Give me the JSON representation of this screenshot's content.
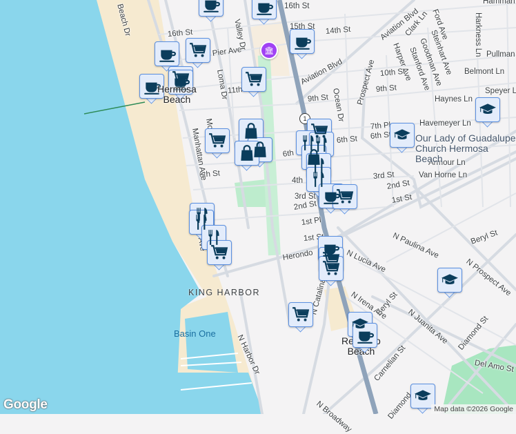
{
  "map": {
    "places": {
      "hermosa_1": "Hermosa",
      "hermosa_2": "Beach",
      "redondo_1": "Redondo",
      "redondo_2": "Beach",
      "king_harbor": "KING HARBOR",
      "basin_one": "Basin One",
      "church_1": "Our Lady of Guadalupe",
      "church_2": "Church Hermosa Beach"
    },
    "highway_shield": "1",
    "streets": [
      "16th St",
      "15th St",
      "14th St",
      "16th St",
      "Pier Ave",
      "Valley Dr",
      "Loma Dr",
      "11th St",
      "Aviation Blvd",
      "Aviation Blvd",
      "Prospect Ave",
      "Harper Ave",
      "Clark Ln",
      "Stanford Ave",
      "Goodman Ave",
      "Steinhart Ave",
      "Ford Ave",
      "Harkness Ln",
      "Hamman",
      "Pullman Ln",
      "Belmont Ln",
      "10th St",
      "9th St",
      "9th St",
      "Ocean Dr",
      "Speyer Ln",
      "Haynes Ln",
      "Havemeyer Ln",
      "7th Pl",
      "6th St",
      "6th St",
      "6th St",
      "Armour Ln",
      "Van Horne Ln",
      "3rd St",
      "2nd St",
      "1st St",
      "4th",
      "3rd St",
      "2nd St",
      "1st Pl",
      "1st St",
      "Herondo",
      "N Lucia Ave",
      "N Paulina Ave",
      "Beryl St",
      "N Prospect Ave",
      "N Irena Ave",
      "N Catalina",
      "Beryl St",
      "N Juanita Ave",
      "Diamond St",
      "Del Amo St",
      "Carnelian St",
      "N Broadway",
      "Diamond",
      "6th St",
      "Manhattan Ave",
      "Monterey",
      "Hermosa Ave",
      "Beach Dr",
      "N Harbor Dr"
    ],
    "markers": [
      "cafe",
      "cafe",
      "cafe",
      "cafe",
      "shopping-cart",
      "shopping-cart",
      "cafe",
      "cafe",
      "shopping-cart",
      "shopping-cart",
      "shopping-bag",
      "shopping-bag",
      "shopping-bag",
      "shopping-cart",
      "restaurant",
      "restaurant",
      "shopping-bag",
      "restaurant",
      "restaurant",
      "cafe",
      "shopping-cart",
      "restaurant",
      "restaurant",
      "restaurant",
      "shopping-cart",
      "cafe",
      "shopping-cart",
      "shopping-cart",
      "shopping-cart",
      "school",
      "school",
      "school",
      "school",
      "cafe",
      "school"
    ],
    "museum_icon": "museum-icon",
    "colors": {
      "water": "#8ad6ec",
      "sand": "#f6ead0",
      "land": "#f4f3f4",
      "road": "#d6dbe2",
      "highway": "#8fa3ba",
      "park": "#a8e6c0",
      "marker_fill": "#e3ecfb",
      "marker_border": "#5a8fe0",
      "icon": "#0b3d5c"
    }
  },
  "attribution": "Map data ©2026 Google",
  "logo": "Google"
}
